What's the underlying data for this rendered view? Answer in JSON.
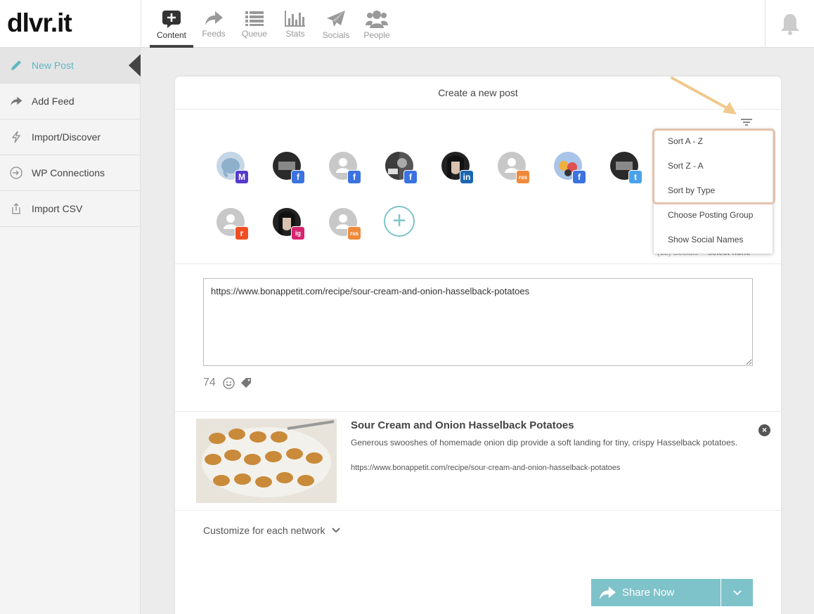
{
  "app": {
    "logo": "dlvr.it"
  },
  "nav": {
    "items": [
      {
        "label": "Content",
        "icon": "plus-square-icon",
        "active": true
      },
      {
        "label": "Feeds",
        "icon": "share-arrow-icon"
      },
      {
        "label": "Queue",
        "icon": "list-icon"
      },
      {
        "label": "Stats",
        "icon": "bar-chart-icon"
      },
      {
        "label": "Socials",
        "icon": "paper-plane-icon"
      },
      {
        "label": "People",
        "icon": "people-icon"
      }
    ],
    "bell_icon": "bell-icon"
  },
  "sidebar": {
    "items": [
      {
        "label": "New Post",
        "icon": "pencil-icon",
        "active": true
      },
      {
        "label": "Add Feed",
        "icon": "share-arrow-icon"
      },
      {
        "label": "Import/Discover",
        "icon": "lightning-icon"
      },
      {
        "label": "WP Connections",
        "icon": "sign-in-icon"
      },
      {
        "label": "Import CSV",
        "icon": "upload-icon"
      }
    ]
  },
  "card": {
    "title": "Create a new post",
    "socials": [
      {
        "network": "mastodon",
        "badge": "M",
        "badge_color": "#563acc"
      },
      {
        "network": "facebook",
        "badge": "f",
        "badge_color": "#3b73e0"
      },
      {
        "network": "facebook",
        "badge": "f",
        "badge_color": "#3b73e0"
      },
      {
        "network": "facebook",
        "badge": "f",
        "badge_color": "#3b73e0"
      },
      {
        "network": "linkedin",
        "badge": "in",
        "badge_color": "#1a66b0"
      },
      {
        "network": "rss",
        "badge": "rss",
        "badge_color": "#ef8a3b"
      },
      {
        "network": "facebook",
        "badge": "f",
        "badge_color": "#3b73e0"
      },
      {
        "network": "twitter",
        "badge": "t",
        "badge_color": "#4aa3ea"
      },
      {
        "network": "reddit",
        "badge": "r",
        "badge_color": "#f04d23"
      },
      {
        "network": "instagram",
        "badge": "ig",
        "badge_color": "#d6246e"
      },
      {
        "network": "rss",
        "badge": "rss",
        "badge_color": "#ef8a3b"
      }
    ],
    "socials_count": "(12) Socials",
    "select_none": "select none",
    "post_text": "https://www.bonappetit.com/recipe/sour-cream-and-onion-hasselback-potatoes",
    "char_count": "74",
    "preview": {
      "title": "Sour Cream and Onion Hasselback Potatoes",
      "description": "Generous swooshes of homemade onion dip provide a soft landing for tiny, crispy Hasselback potatoes.",
      "url": "https://www.bonappetit.com/recipe/sour-cream-and-onion-hasselback-potatoes",
      "close": "×"
    },
    "customize_label": "Customize for each network",
    "share_label": "Share Now"
  },
  "dropdown": {
    "items": [
      "Sort A - Z",
      "Sort Z - A",
      "Sort by Type",
      "Choose Posting Group",
      "Show Social Names"
    ]
  },
  "colors": {
    "accent": "#5fb8c2",
    "button": "#7ec3ca",
    "highlight": "#e3c3ad",
    "annotation_arrow": "#f0c98c"
  }
}
